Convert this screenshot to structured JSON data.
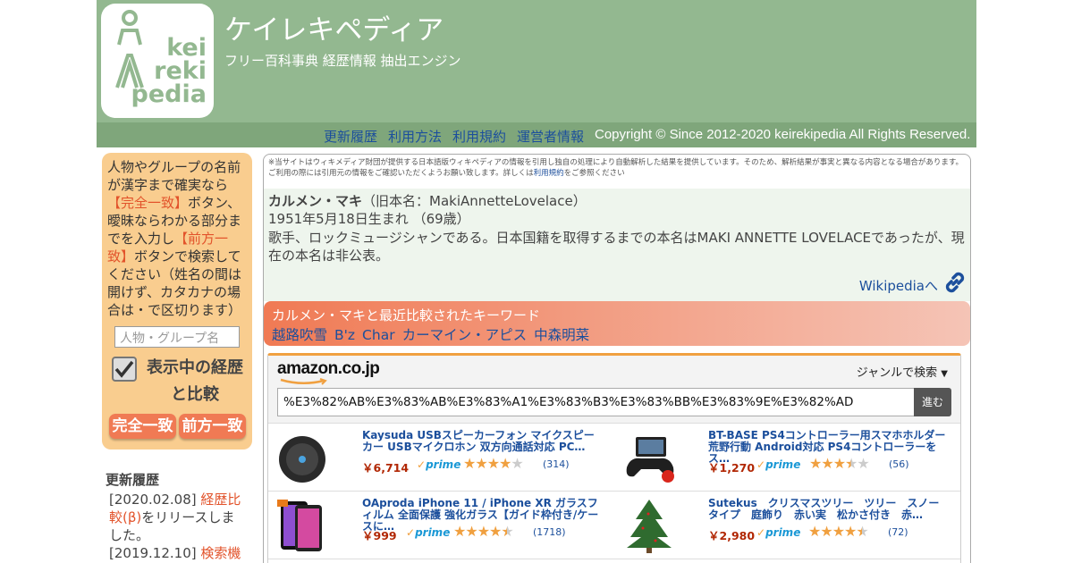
{
  "header": {
    "logo_text": [
      "kei",
      "reki",
      "pedia"
    ],
    "title": "ケイレキペディア",
    "subtitle": "フリー百科事典 経歴情報 抽出エンジン",
    "nav": [
      "更新履歴",
      "利用方法",
      "利用規約",
      "運営者情報"
    ],
    "copyright": "Copyright © Since 2012-2020  keirekipedia All Rights Reserved."
  },
  "sidebar": {
    "help_1": "人物やグループの名前が漢字まで確実なら",
    "help_hl_1": "【完全一致】",
    "help_2": "ボタン、曖昧ならわかる部分までを入力し",
    "help_hl_2": "【前方一致】",
    "help_3": "ボタンで検索してください（姓名の間は開けず、カタカナの場合は・で区切ります）",
    "search_placeholder": "人物・グループ名",
    "compare_label": "表示中の経歴と比較",
    "exact_button": "完全一致",
    "prefix_button": "前方一致",
    "updates_title": "更新履歴",
    "update_1_date": "[2020.02.08] ",
    "update_1_link": "経歴比較(β)",
    "update_1_text": "をリリースしました。",
    "update_2_date": "[2019.12.10] ",
    "update_2_link": "検索機能"
  },
  "notice": {
    "text": "※当サイトはウィキメディア財団が提供する日本語版ウィキペディアの情報を引用し独自の処理により自動解析した結果を提供しています。そのため、解析結果が事実と異なる内容となる場合があります。ご利用の際には引用元の情報をご確認いただくようお願い致します。詳しくは",
    "link": "利用規約",
    "tail": "をご参照ください"
  },
  "person": {
    "name": "カルメン・マキ",
    "alias": "（旧本名：MakiAnnetteLovelace）",
    "birth": "1951年5月18日生まれ （69歳）",
    "description": "歌手、ロックミュージシャンである。日本国籍を取得するまでの本名はMAKI ANNETTE LOVELACEであったが、現在の本名は非公表。",
    "wiki_link": "Wikipediaへ"
  },
  "keywords": {
    "title": "カルメン・マキと最近比較されたキーワード",
    "items": [
      "越路吹雪",
      "B'z",
      "Char",
      "カーマイン・アピス",
      "中森明菜"
    ]
  },
  "amazon": {
    "logo": "amazon.co.jp",
    "genre": "ジャンルで検索",
    "query": "%E3%82%AB%E3%83%AB%E3%83%A1%E3%83%B3%E3%83%BB%E3%83%9E%E3%82%AD",
    "go": "進む",
    "prime": "prime",
    "products": [
      {
        "title": "Kaysuda USBスピーカーフォン マイクスピーカー USBマイクロホン 双方向通話対応 PC…",
        "price": "￥6,714",
        "rating": 4.0,
        "reviews": "(314)"
      },
      {
        "title": "BT-BASE PS4コントローラー用スマホホルダー 荒野行動 Android対応 PS4コントローラーをス…",
        "price": "￥1,270",
        "rating": 3.5,
        "reviews": "(56)"
      },
      {
        "title": "OAproda iPhone 11 / iPhone XR ガラスフィルム 全面保護 強化ガラス【ガイド枠付き/ケースに…",
        "price": "￥999",
        "rating": 4.5,
        "reviews": "(1718)"
      },
      {
        "title": "Sutekus　クリスマスツリー　ツリー　スノータイプ　庭飾り　赤い実　松かさ付き　赤…",
        "price": "￥2,980",
        "rating": 4.5,
        "reviews": "(72)"
      }
    ]
  }
}
